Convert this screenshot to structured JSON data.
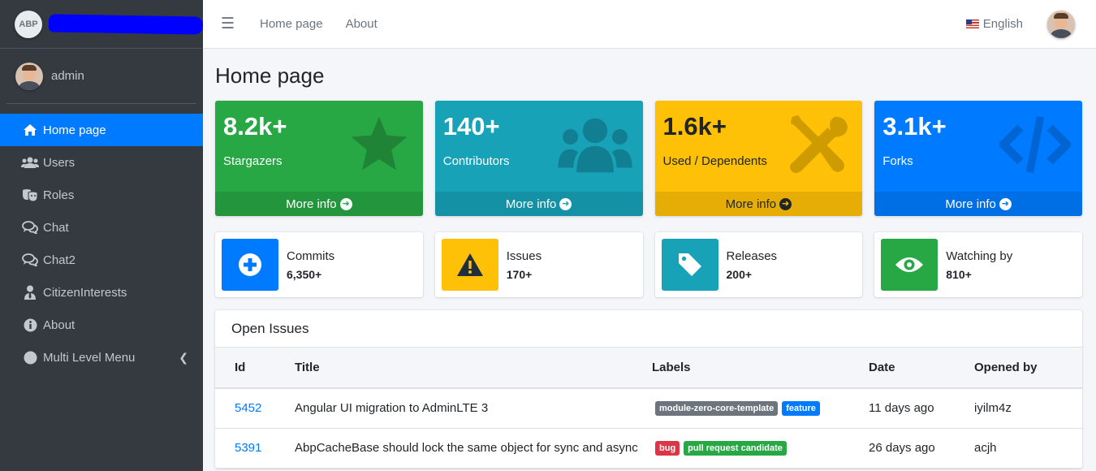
{
  "sidebar": {
    "logo_text": "ABP",
    "user_name": "admin",
    "items": [
      {
        "label": "Home page",
        "icon": "home-icon",
        "active": true
      },
      {
        "label": "Users",
        "icon": "users-icon"
      },
      {
        "label": "Roles",
        "icon": "theater-masks-icon"
      },
      {
        "label": "Chat",
        "icon": "comments-icon"
      },
      {
        "label": "Chat2",
        "icon": "comments-icon"
      },
      {
        "label": "CitizenInterests",
        "icon": "user-tie-icon"
      },
      {
        "label": "About",
        "icon": "info-circle-icon"
      },
      {
        "label": "Multi Level Menu",
        "icon": "circle-icon",
        "has_arrow": true
      }
    ]
  },
  "topbar": {
    "links": [
      "Home page",
      "About"
    ],
    "language": "English"
  },
  "page_title": "Home page",
  "stats": [
    {
      "value": "8.2k+",
      "label": "Stargazers",
      "footer": "More info",
      "icon": "star-icon",
      "color": "#28a745"
    },
    {
      "value": "140+",
      "label": "Contributors",
      "footer": "More info",
      "icon": "users-icon",
      "color": "#17a2b8"
    },
    {
      "value": "1.6k+",
      "label": "Used / Dependents",
      "footer": "More info",
      "icon": "tools-icon",
      "color": "#ffc107"
    },
    {
      "value": "3.1k+",
      "label": "Forks",
      "footer": "More info",
      "icon": "code-icon",
      "color": "#007bff"
    }
  ],
  "info_boxes": [
    {
      "label": "Commits",
      "value": "6,350+",
      "icon": "plus-circle-icon",
      "color": "#007bff"
    },
    {
      "label": "Issues",
      "value": "170+",
      "icon": "warning-icon",
      "color": "#ffc107"
    },
    {
      "label": "Releases",
      "value": "200+",
      "icon": "tag-icon",
      "color": "#17a2b8"
    },
    {
      "label": "Watching by",
      "value": "810+",
      "icon": "eye-icon",
      "color": "#28a745"
    }
  ],
  "issues_card": {
    "title": "Open Issues",
    "columns": [
      "Id",
      "Title",
      "Labels",
      "Date",
      "Opened by"
    ],
    "rows": [
      {
        "id": "5452",
        "title": "Angular UI migration to AdminLTE 3",
        "labels": [
          {
            "text": "module-zero-core-template",
            "color": "#6c757d"
          },
          {
            "text": "feature",
            "color": "#007bff"
          }
        ],
        "date": "11 days ago",
        "opened_by": "iyilm4z"
      },
      {
        "id": "5391",
        "title": "AbpCacheBase should lock the same object for sync and async",
        "labels": [
          {
            "text": "bug",
            "color": "#dc3545"
          },
          {
            "text": "pull request candidate",
            "color": "#28a745"
          }
        ],
        "date": "26 days ago",
        "opened_by": "acjh"
      }
    ]
  }
}
